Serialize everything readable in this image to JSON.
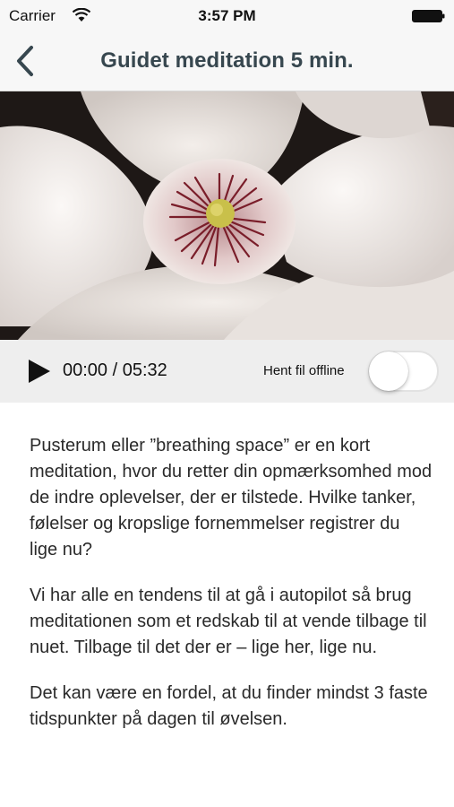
{
  "status_bar": {
    "carrier": "Carrier",
    "time": "3:57 PM",
    "wifi_icon": "wifi-icon",
    "battery_icon": "battery-icon"
  },
  "nav": {
    "back_icon": "chevron-left-icon",
    "title": "Guidet meditation 5 min."
  },
  "hero": {
    "image": "magnolia-flower-photo"
  },
  "player": {
    "play_icon": "play-icon",
    "time": "00:00 / 05:32",
    "offline_label": "Hent fil offline",
    "offline_enabled": false
  },
  "content": {
    "paragraphs": [
      "Pusterum eller ”breathing space” er en kort meditation, hvor du retter din opmærksomhed mod de indre oplevelser, der er tilstede. Hvilke tanker, følelser og kropslige fornemmelser registrer du lige nu?",
      "Vi har alle en tendens til at gå i autopilot så brug meditationen som et redskab til at vende tilbage til nuet. Tilbage til det der er – lige her, lige nu.",
      "Det kan være en fordel, at du finder mindst 3 faste tidspunkter på dagen til øvelsen."
    ]
  },
  "colors": {
    "title": "#37474f",
    "bar_background": "#f7f7f7",
    "player_background": "#eeeeee"
  }
}
